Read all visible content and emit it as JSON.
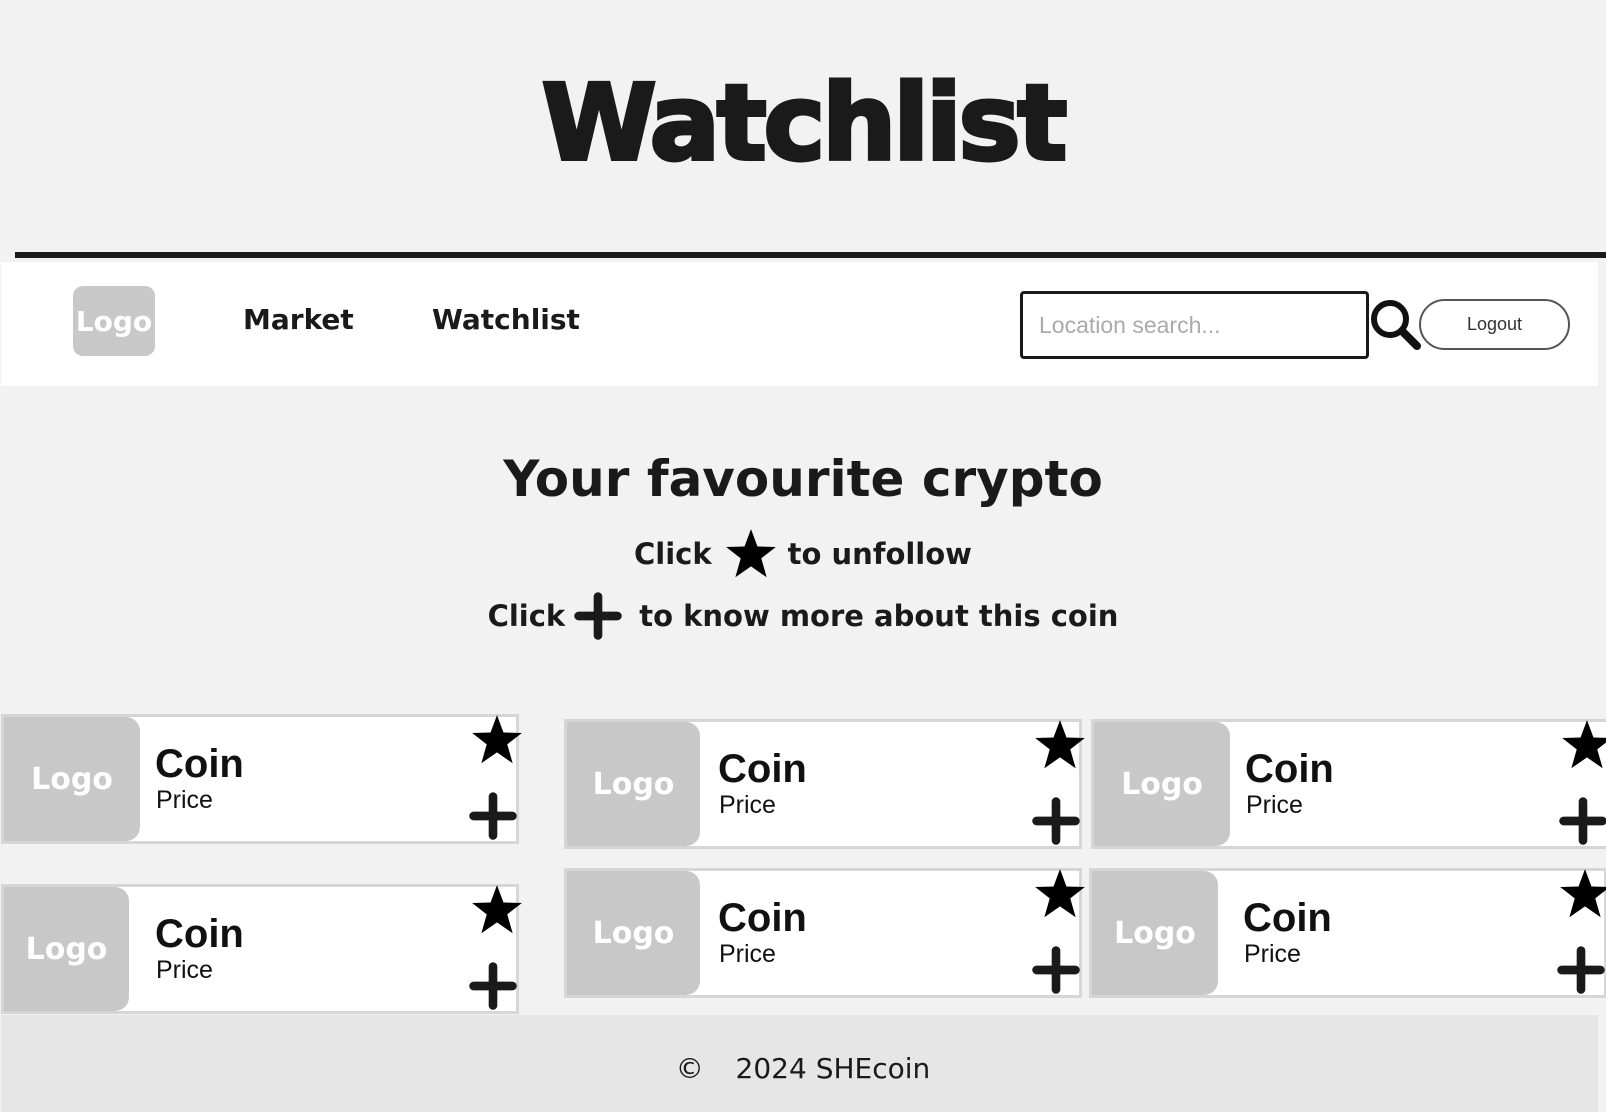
{
  "header": {
    "title": "Watchlist"
  },
  "nav": {
    "logo_label": "Logo",
    "links": [
      {
        "label": "Market"
      },
      {
        "label": "Watchlist"
      }
    ],
    "search": {
      "placeholder": "Location search...",
      "value": ""
    },
    "logout_label": "Logout"
  },
  "intro": {
    "heading": "Your favourite crypto",
    "hint_unfollow": {
      "prefix": "Click",
      "suffix": "to unfollow"
    },
    "hint_more": {
      "prefix": "Click",
      "suffix": "to know more about this coin"
    }
  },
  "cards": [
    {
      "logo": "Logo",
      "name": "Coin",
      "price": "Price"
    },
    {
      "logo": "Logo",
      "name": "Coin",
      "price": "Price"
    },
    {
      "logo": "Logo",
      "name": "Coin",
      "price": "Price"
    },
    {
      "logo": "Logo",
      "name": "Coin",
      "price": "Price"
    },
    {
      "logo": "Logo",
      "name": "Coin",
      "price": "Price"
    },
    {
      "logo": "Logo",
      "name": "Coin",
      "price": "Price"
    }
  ],
  "footer": {
    "copyright_symbol": "©",
    "text": "2024 SHEcoin"
  },
  "colors": {
    "background": "#f2f2f2",
    "text": "#1a1a1a",
    "placeholder_grey": "#c8c8c8",
    "card_border": "#d6d6d6",
    "footer_bg": "#e6e6e6"
  },
  "icons": {
    "unfollow": "star-icon",
    "more_info": "plus-icon",
    "search": "search-icon"
  }
}
